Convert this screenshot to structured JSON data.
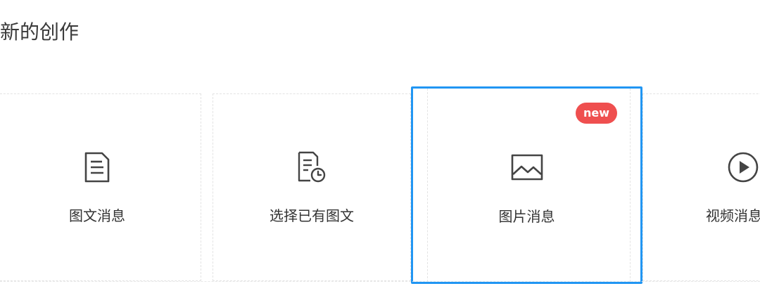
{
  "section": {
    "title": "新的创作"
  },
  "cards": [
    {
      "label": "图文消息",
      "icon": "document-icon"
    },
    {
      "label": "选择已有图文",
      "icon": "document-clock-icon"
    },
    {
      "label": "图片消息",
      "icon": "image-icon",
      "badge": "new",
      "selected": true
    },
    {
      "label": "视频消息",
      "icon": "play-circle-icon"
    }
  ],
  "colors": {
    "selected_border": "#2196f3",
    "badge_bg": "#ef4f4f",
    "icon": "#444444"
  }
}
